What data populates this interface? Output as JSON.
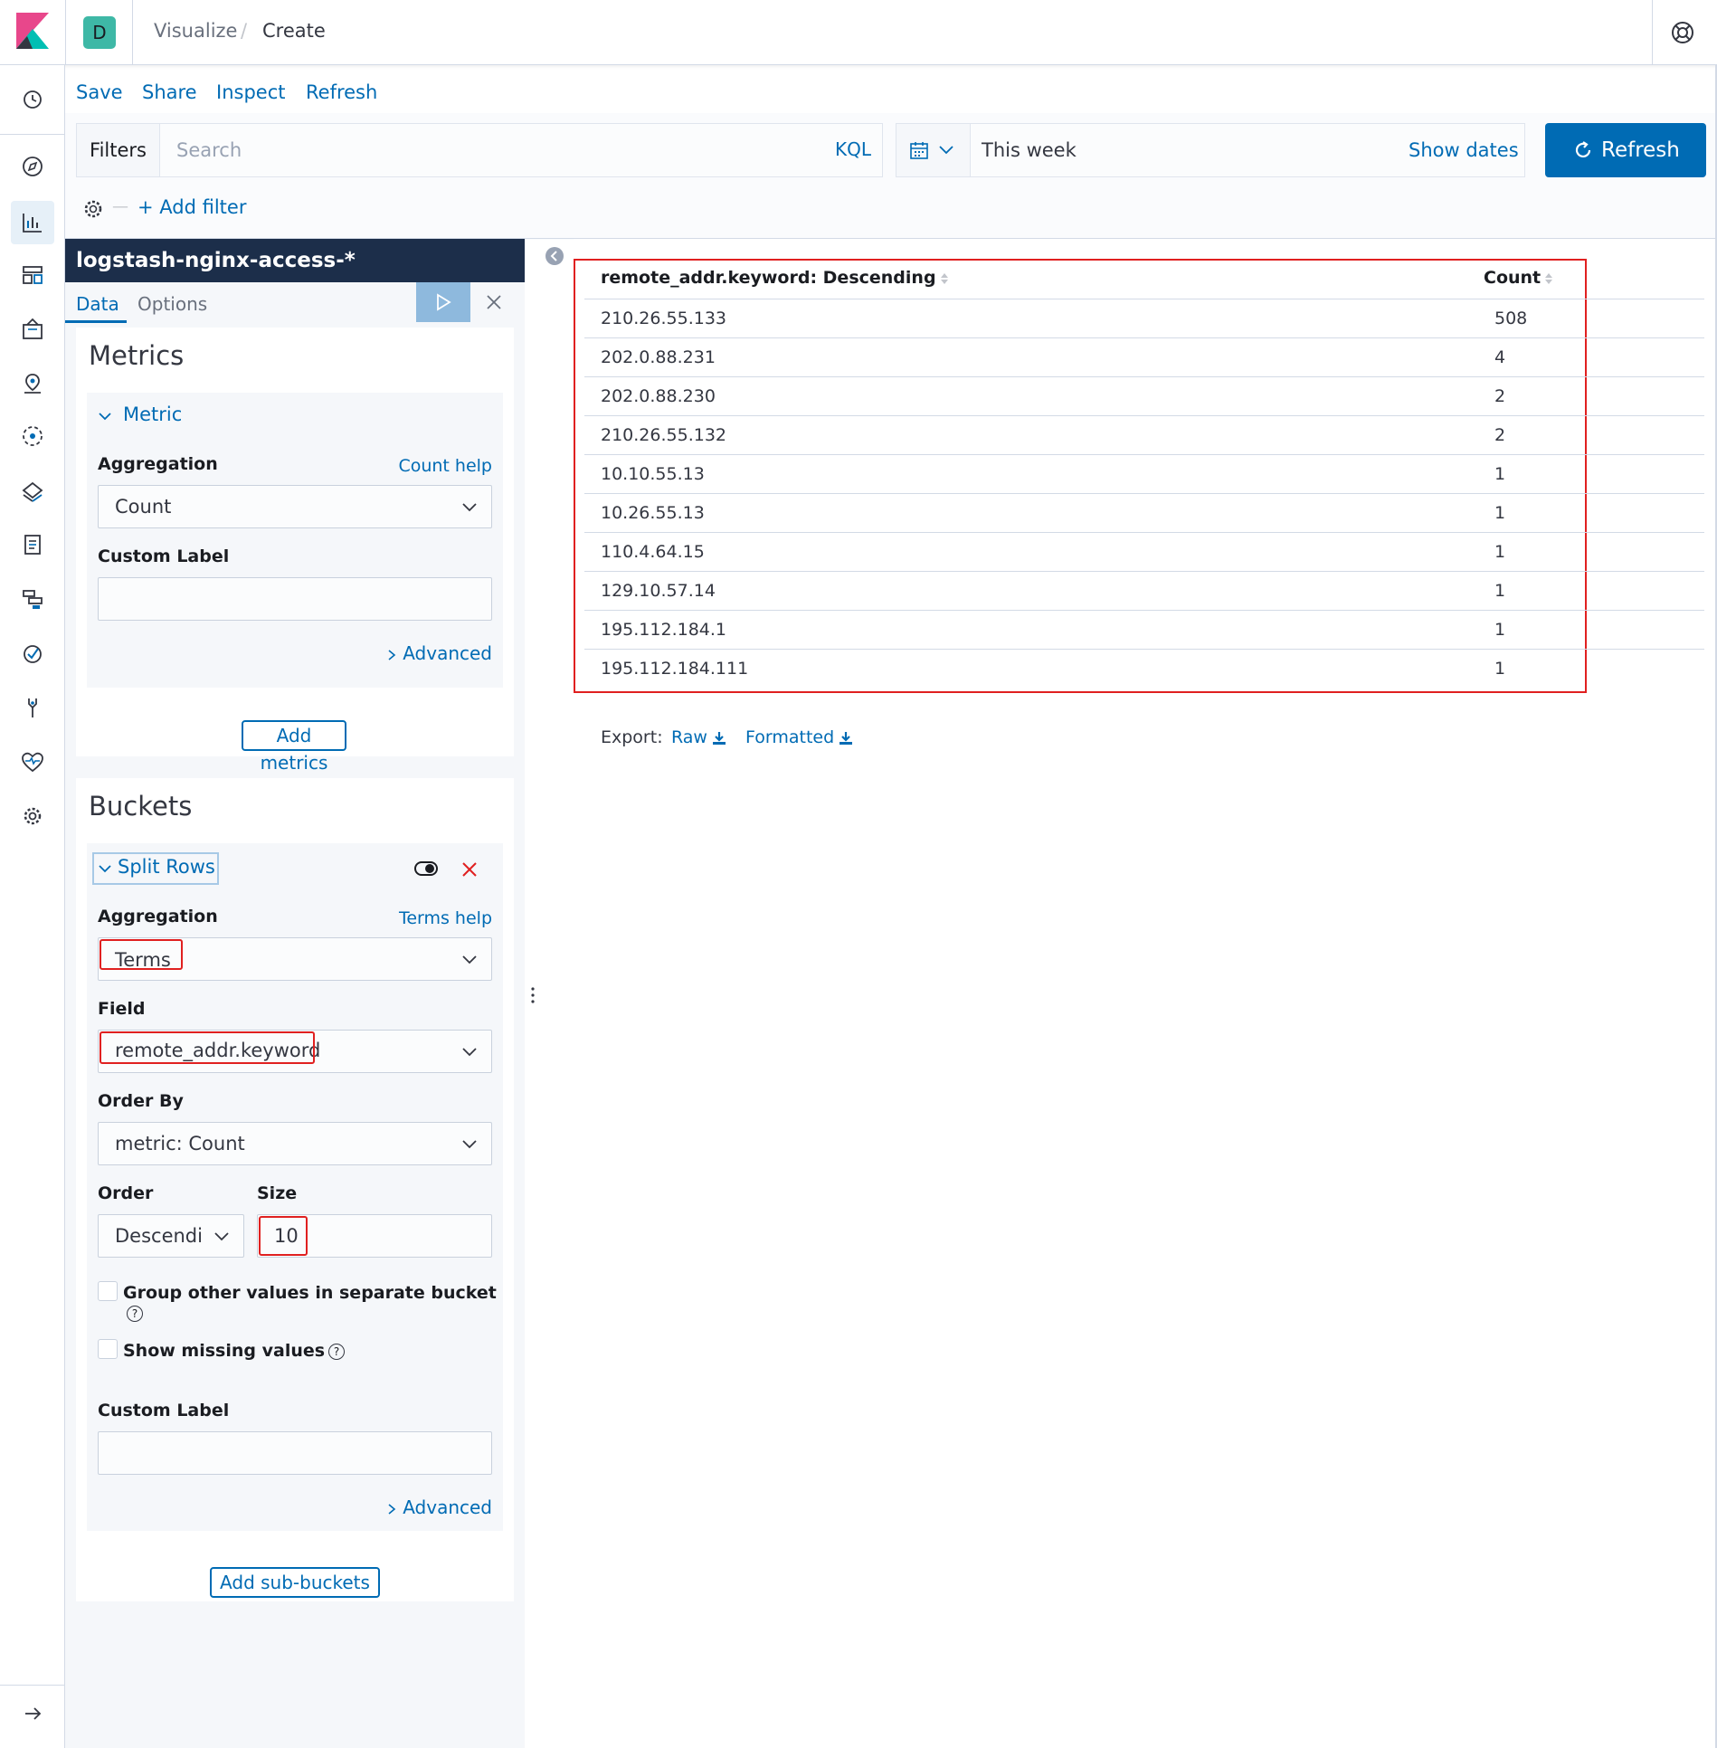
{
  "header": {
    "space_initial": "D",
    "breadcrumbs": [
      "Visualize",
      "Create"
    ],
    "breadcrumb_sep": "/"
  },
  "nav_icons": [
    "clock-icon",
    "compass-icon",
    "visualize-icon",
    "dashboard-icon",
    "canvas-icon",
    "maps-icon",
    "ml-icon",
    "infrastructure-icon",
    "logs-icon",
    "apm-icon",
    "uptime-icon",
    "dev-tools-icon",
    "monitoring-icon",
    "management-icon"
  ],
  "top_menu": {
    "save": "Save",
    "share": "Share",
    "inspect": "Inspect",
    "refresh": "Refresh"
  },
  "query_bar": {
    "filters_label": "Filters",
    "search_placeholder": "Search",
    "kql": "KQL",
    "date_value": "This week",
    "show_dates": "Show dates",
    "refresh_button": "Refresh",
    "add_filter": "+ Add filter"
  },
  "sidebar": {
    "index_pattern": "logstash-nginx-access-*",
    "tabs": {
      "data": "Data",
      "options": "Options"
    },
    "metrics": {
      "title": "Metrics",
      "accordion": "Metric",
      "aggregation_label": "Aggregation",
      "aggregation_help": "Count help",
      "aggregation_value": "Count",
      "custom_label": "Custom Label",
      "custom_label_value": "",
      "advanced": "Advanced",
      "add_button": "Add metrics"
    },
    "buckets": {
      "title": "Buckets",
      "accordion": "Split Rows",
      "aggregation_label": "Aggregation",
      "aggregation_help": "Terms help",
      "aggregation_value": "Terms",
      "field_label": "Field",
      "field_value": "remote_addr.keyword",
      "order_by_label": "Order By",
      "order_by_value": "metric: Count",
      "order_label": "Order",
      "order_value": "Descendi",
      "size_label": "Size",
      "size_value": "10",
      "group_other": "Group other values in separate bucket",
      "show_missing": "Show missing values",
      "custom_label": "Custom Label",
      "custom_label_value": "",
      "advanced": "Advanced",
      "add_button": "Add sub-buckets"
    }
  },
  "table": {
    "columns": [
      "remote_addr.keyword: Descending",
      "Count"
    ],
    "rows": [
      [
        "210.26.55.133",
        "508"
      ],
      [
        "202.0.88.231",
        "4"
      ],
      [
        "202.0.88.230",
        "2"
      ],
      [
        "210.26.55.132",
        "2"
      ],
      [
        "10.10.55.13",
        "1"
      ],
      [
        "10.26.55.13",
        "1"
      ],
      [
        "110.4.64.15",
        "1"
      ],
      [
        "129.10.57.14",
        "1"
      ],
      [
        "195.112.184.1",
        "1"
      ],
      [
        "195.112.184.111",
        "1"
      ]
    ],
    "export_label": "Export:",
    "export_raw": "Raw",
    "export_formatted": "Formatted"
  },
  "colors": {
    "accent": "#006bb4",
    "annotation": "#e02020",
    "sidebar_header": "#1c2e4a"
  }
}
